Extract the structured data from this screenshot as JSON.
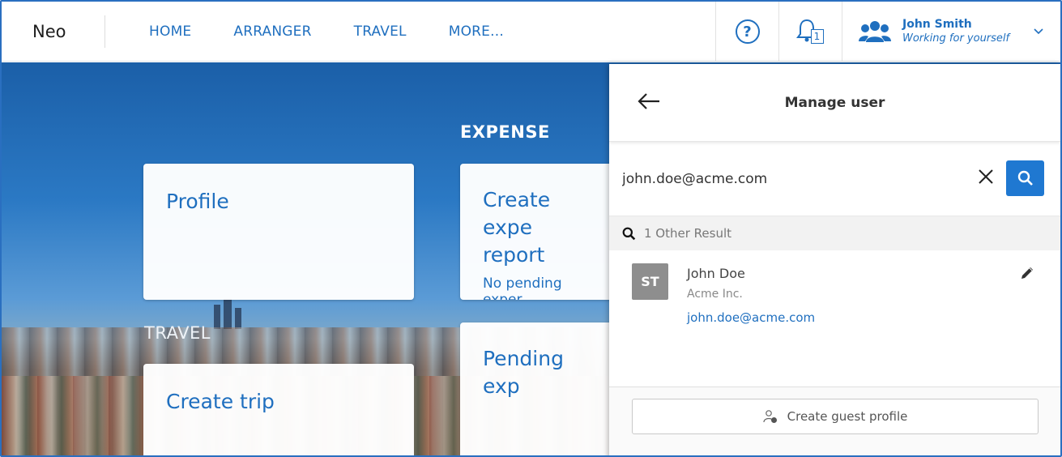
{
  "nav": {
    "brand": "Neo",
    "items": [
      {
        "label": "HOME"
      },
      {
        "label": "ARRANGER"
      },
      {
        "label": "TRAVEL"
      },
      {
        "label": "MORE..."
      }
    ],
    "help_icon": "?",
    "notification_count": "1",
    "user": {
      "name": "John Smith",
      "subtitle": "Working for yourself"
    }
  },
  "dashboard": {
    "sections": {
      "expense": "EXPENSE",
      "travel": "TRAVEL"
    },
    "cards": {
      "profile": {
        "title": "Profile"
      },
      "create_expense": {
        "title": "Create expe",
        "title2": "report",
        "subtitle": "No pending exper"
      },
      "create_trip": {
        "title": "Create trip"
      },
      "pending_expense": {
        "title": "Pending exp"
      }
    }
  },
  "panel": {
    "title": "Manage user",
    "search_value": "john.doe@acme.com",
    "results_label": "1 Other Result",
    "result": {
      "initials": "ST",
      "name": "John Doe",
      "company": "Acme Inc.",
      "email": "john.doe@acme.com"
    },
    "guest_button": "Create guest profile"
  },
  "colors": {
    "accent": "#1f6fbf",
    "search_button": "#1f78d1",
    "avatar_bg": "#8e8e8e"
  }
}
